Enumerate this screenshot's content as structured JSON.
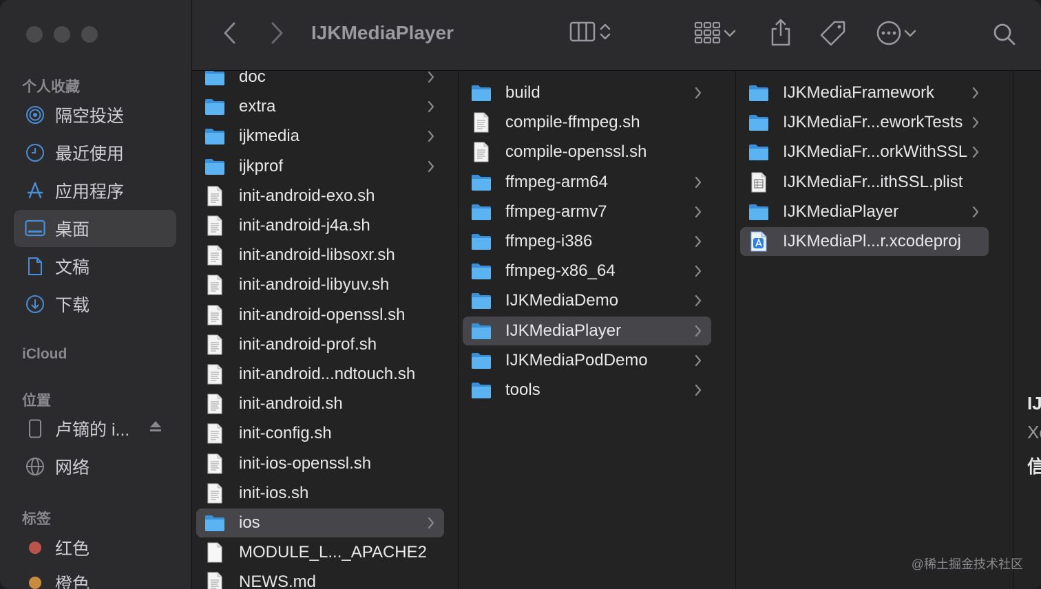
{
  "window": {
    "title": "IJKMediaPlayer"
  },
  "colors": {
    "folder": "#4aa7ee",
    "sidebar_icon": "#4a8ed8",
    "tag_red": "#b9544d",
    "tag_orange": "#c98b3d"
  },
  "sidebar": {
    "sections": {
      "favorites": "个人收藏",
      "icloud": "iCloud",
      "locations": "位置",
      "tags": "标签"
    },
    "favorites": [
      {
        "label": "隔空投送",
        "icon": "airdrop-icon"
      },
      {
        "label": "最近使用",
        "icon": "clock-icon"
      },
      {
        "label": "应用程序",
        "icon": "applications-icon"
      },
      {
        "label": "桌面",
        "icon": "desktop-icon",
        "selected": true
      },
      {
        "label": "文稿",
        "icon": "document-icon"
      },
      {
        "label": "下载",
        "icon": "download-icon"
      }
    ],
    "locations": [
      {
        "label": "卢镝的 i...",
        "icon": "phone-icon"
      },
      {
        "label": "网络",
        "icon": "network-icon"
      }
    ],
    "tags": [
      {
        "label": "红色"
      },
      {
        "label": "橙色"
      }
    ]
  },
  "columns": [
    {
      "items": [
        {
          "name": "doc",
          "type": "folder"
        },
        {
          "name": "extra",
          "type": "folder"
        },
        {
          "name": "ijkmedia",
          "type": "folder"
        },
        {
          "name": "ijkprof",
          "type": "folder"
        },
        {
          "name": "init-android-exo.sh",
          "type": "file"
        },
        {
          "name": "init-android-j4a.sh",
          "type": "file"
        },
        {
          "name": "init-android-libsoxr.sh",
          "type": "file"
        },
        {
          "name": "init-android-libyuv.sh",
          "type": "file"
        },
        {
          "name": "init-android-openssl.sh",
          "type": "file"
        },
        {
          "name": "init-android-prof.sh",
          "type": "file"
        },
        {
          "name": "init-android...ndtouch.sh",
          "type": "file"
        },
        {
          "name": "init-android.sh",
          "type": "file"
        },
        {
          "name": "init-config.sh",
          "type": "file"
        },
        {
          "name": "init-ios-openssl.sh",
          "type": "file"
        },
        {
          "name": "init-ios.sh",
          "type": "file"
        },
        {
          "name": "ios",
          "type": "folder",
          "selected": true
        },
        {
          "name": "MODULE_L..._APACHE2",
          "type": "blank"
        },
        {
          "name": "NEWS.md",
          "type": "file"
        }
      ]
    },
    {
      "items": [
        {
          "name": "build",
          "type": "folder"
        },
        {
          "name": "compile-ffmpeg.sh",
          "type": "file"
        },
        {
          "name": "compile-openssl.sh",
          "type": "file"
        },
        {
          "name": "ffmpeg-arm64",
          "type": "folder"
        },
        {
          "name": "ffmpeg-armv7",
          "type": "folder"
        },
        {
          "name": "ffmpeg-i386",
          "type": "folder"
        },
        {
          "name": "ffmpeg-x86_64",
          "type": "folder"
        },
        {
          "name": "IJKMediaDemo",
          "type": "folder"
        },
        {
          "name": "IJKMediaPlayer",
          "type": "folder",
          "selected": true
        },
        {
          "name": "IJKMediaPodDemo",
          "type": "folder"
        },
        {
          "name": "tools",
          "type": "folder"
        }
      ]
    },
    {
      "items": [
        {
          "name": "IJKMediaFramework",
          "type": "folder"
        },
        {
          "name": "IJKMediaFr...eworkTests",
          "type": "folder"
        },
        {
          "name": "IJKMediaFr...orkWithSSL",
          "type": "folder"
        },
        {
          "name": "IJKMediaFr...ithSSL.plist",
          "type": "plist"
        },
        {
          "name": "IJKMediaPlayer",
          "type": "folder"
        },
        {
          "name": "IJKMediaPl...r.xcodeproj",
          "type": "xcodeproj",
          "selected": true
        }
      ]
    }
  ],
  "preview": {
    "line1": "IJ",
    "line2": "Xc",
    "line3": "信"
  },
  "watermark": "@稀土掘金技术社区"
}
